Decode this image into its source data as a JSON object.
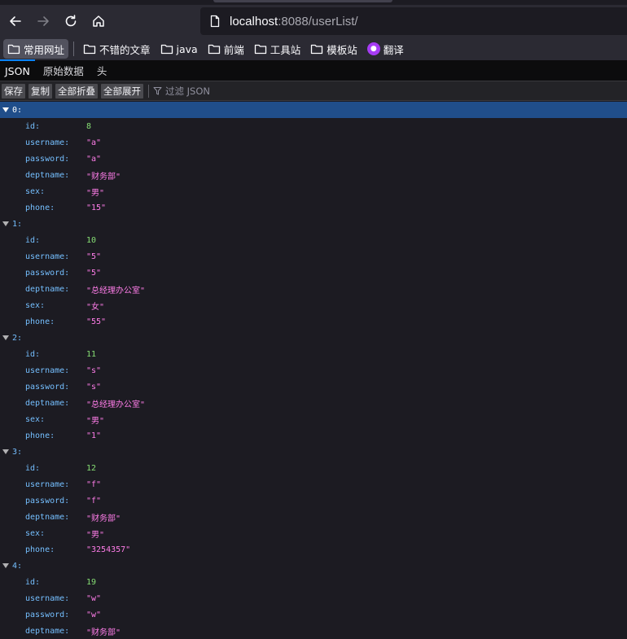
{
  "browser": {
    "url_host": "localhost",
    "url_rest": ":8088/userList/"
  },
  "bookmarks": [
    {
      "label": "常用网址",
      "icon": "folder-icon",
      "active": true
    },
    {
      "label": "不错的文章",
      "icon": "folder-icon"
    },
    {
      "label": "java",
      "icon": "folder-icon"
    },
    {
      "label": "前端",
      "icon": "folder-icon"
    },
    {
      "label": "工具站",
      "icon": "folder-icon"
    },
    {
      "label": "模板站",
      "icon": "folder-icon"
    },
    {
      "label": "翻译",
      "icon": "translate-icon"
    }
  ],
  "viewer": {
    "tabs": [
      "JSON",
      "原始数据",
      "头"
    ],
    "toolbar": {
      "save": "保存",
      "copy": "复制",
      "collapse_all": "全部折叠",
      "expand_all": "全部展开",
      "filter_placeholder": "过滤 JSON"
    }
  },
  "records": [
    {
      "index": "0:",
      "fields": [
        {
          "key": "id:",
          "value": "8",
          "type": "num"
        },
        {
          "key": "username:",
          "value": "\"a\"",
          "type": "str"
        },
        {
          "key": "password:",
          "value": "\"a\"",
          "type": "str"
        },
        {
          "key": "deptname:",
          "value": "\"财务部\"",
          "type": "str"
        },
        {
          "key": "sex:",
          "value": "\"男\"",
          "type": "str"
        },
        {
          "key": "phone:",
          "value": "\"15\"",
          "type": "str"
        }
      ]
    },
    {
      "index": "1:",
      "fields": [
        {
          "key": "id:",
          "value": "10",
          "type": "num"
        },
        {
          "key": "username:",
          "value": "\"5\"",
          "type": "str"
        },
        {
          "key": "password:",
          "value": "\"5\"",
          "type": "str"
        },
        {
          "key": "deptname:",
          "value": "\"总经理办公室\"",
          "type": "str"
        },
        {
          "key": "sex:",
          "value": "\"女\"",
          "type": "str"
        },
        {
          "key": "phone:",
          "value": "\"55\"",
          "type": "str"
        }
      ]
    },
    {
      "index": "2:",
      "fields": [
        {
          "key": "id:",
          "value": "11",
          "type": "num"
        },
        {
          "key": "username:",
          "value": "\"s\"",
          "type": "str"
        },
        {
          "key": "password:",
          "value": "\"s\"",
          "type": "str"
        },
        {
          "key": "deptname:",
          "value": "\"总经理办公室\"",
          "type": "str"
        },
        {
          "key": "sex:",
          "value": "\"男\"",
          "type": "str"
        },
        {
          "key": "phone:",
          "value": "\"1\"",
          "type": "str"
        }
      ]
    },
    {
      "index": "3:",
      "fields": [
        {
          "key": "id:",
          "value": "12",
          "type": "num"
        },
        {
          "key": "username:",
          "value": "\"f\"",
          "type": "str"
        },
        {
          "key": "password:",
          "value": "\"f\"",
          "type": "str"
        },
        {
          "key": "deptname:",
          "value": "\"财务部\"",
          "type": "str"
        },
        {
          "key": "sex:",
          "value": "\"男\"",
          "type": "str"
        },
        {
          "key": "phone:",
          "value": "\"3254357\"",
          "type": "str"
        }
      ]
    },
    {
      "index": "4:",
      "fields": [
        {
          "key": "id:",
          "value": "19",
          "type": "num"
        },
        {
          "key": "username:",
          "value": "\"w\"",
          "type": "str"
        },
        {
          "key": "password:",
          "value": "\"w\"",
          "type": "str"
        },
        {
          "key": "deptname:",
          "value": "\"财务部\"",
          "type": "str"
        }
      ]
    }
  ]
}
